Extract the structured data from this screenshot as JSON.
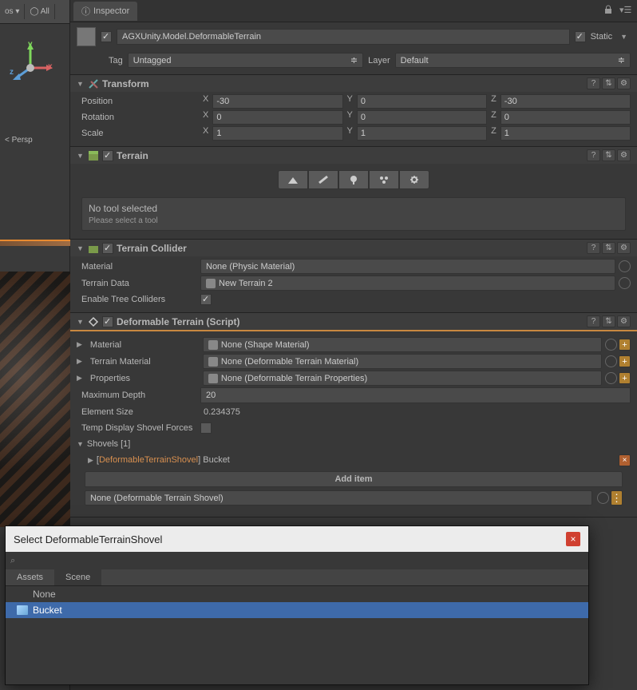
{
  "viewport": {
    "persp": "< Persp",
    "opt1": "os ▾",
    "opt2": "◯ All"
  },
  "tab": {
    "title": "Inspector"
  },
  "header": {
    "name": "AGXUnity.Model.DeformableTerrain",
    "static_label": "Static",
    "tag_label": "Tag",
    "tag_value": "Untagged",
    "layer_label": "Layer",
    "layer_value": "Default"
  },
  "transform": {
    "title": "Transform",
    "position_label": "Position",
    "px": "-30",
    "py": "0",
    "pz": "-30",
    "rotation_label": "Rotation",
    "rx": "0",
    "ry": "0",
    "rz": "0",
    "scale_label": "Scale",
    "sx": "1",
    "sy": "1",
    "sz": "1"
  },
  "terrain": {
    "title": "Terrain",
    "no_tool": "No tool selected",
    "select_tool": "Please select a tool"
  },
  "terrain_collider": {
    "title": "Terrain Collider",
    "material_label": "Material",
    "material_value": "None (Physic Material)",
    "terrain_data_label": "Terrain Data",
    "terrain_data_value": "New Terrain 2",
    "tree_colliders_label": "Enable Tree Colliders"
  },
  "deformable": {
    "title": "Deformable Terrain (Script)",
    "material_label": "Material",
    "material_value": "None (Shape Material)",
    "terrain_material_label": "Terrain Material",
    "terrain_material_value": "None (Deformable Terrain Material)",
    "properties_label": "Properties",
    "properties_value": "None (Deformable Terrain Properties)",
    "max_depth_label": "Maximum Depth",
    "max_depth_value": "20",
    "element_size_label": "Element Size",
    "element_size_value": "0.234375",
    "temp_forces_label": "Temp Display Shovel Forces",
    "shovels_label": "Shovels [1]",
    "shovel_item_type": "DeformableTerrainShovel",
    "shovel_item_name": "Bucket",
    "add_item": "Add item",
    "add_item_field": "None (Deformable Terrain Shovel)"
  },
  "picker": {
    "title": "Select DeformableTerrainShovel",
    "tab_assets": "Assets",
    "tab_scene": "Scene",
    "item_none": "None",
    "item_bucket": "Bucket"
  }
}
